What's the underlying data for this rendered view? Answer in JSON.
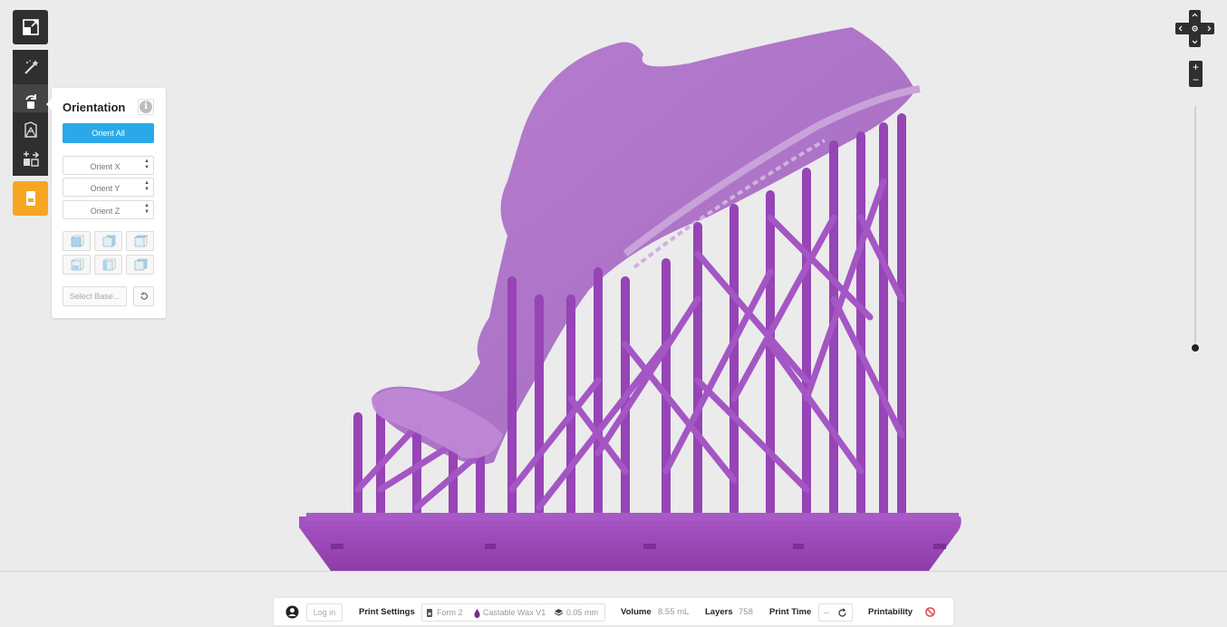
{
  "toolbar": {
    "tools": [
      {
        "name": "scale",
        "icon": "expand-icon"
      },
      {
        "name": "magic",
        "icon": "magic-wand-icon"
      },
      {
        "name": "orientation",
        "icon": "rotate-icon"
      },
      {
        "name": "supports",
        "icon": "supports-icon"
      },
      {
        "name": "layout",
        "icon": "layout-icon"
      },
      {
        "name": "printability",
        "icon": "printer-icon"
      }
    ]
  },
  "orientation_panel": {
    "title": "Orientation",
    "info_glyph": "i",
    "orient_all_label": "Orient All",
    "orient_x_placeholder": "Orient X",
    "orient_y_placeholder": "Orient Y",
    "orient_z_placeholder": "Orient Z",
    "select_base_label": "Select Base...",
    "face_buttons": [
      "face-front",
      "face-back",
      "face-right",
      "face-left",
      "face-top",
      "face-bottom"
    ]
  },
  "view_controls": {
    "zoom_in": "+",
    "zoom_out": "−"
  },
  "status_bar": {
    "login_label": "Log in",
    "print_settings_label": "Print Settings",
    "printer": "Form 2",
    "material": "Castable Wax V1",
    "layer_thickness": "0.05 mm",
    "volume_label": "Volume",
    "volume_value": "8.55 mL",
    "layers_label": "Layers",
    "layers_value": "758",
    "print_time_label": "Print Time",
    "print_time_value": "--",
    "printability_label": "Printability"
  },
  "colors": {
    "model": "#9b4fb3",
    "accent_blue": "#2ba8e8",
    "accent_orange": "#f6a623",
    "toolbar_dark": "#2f2f2f",
    "error_red": "#e0393e"
  }
}
